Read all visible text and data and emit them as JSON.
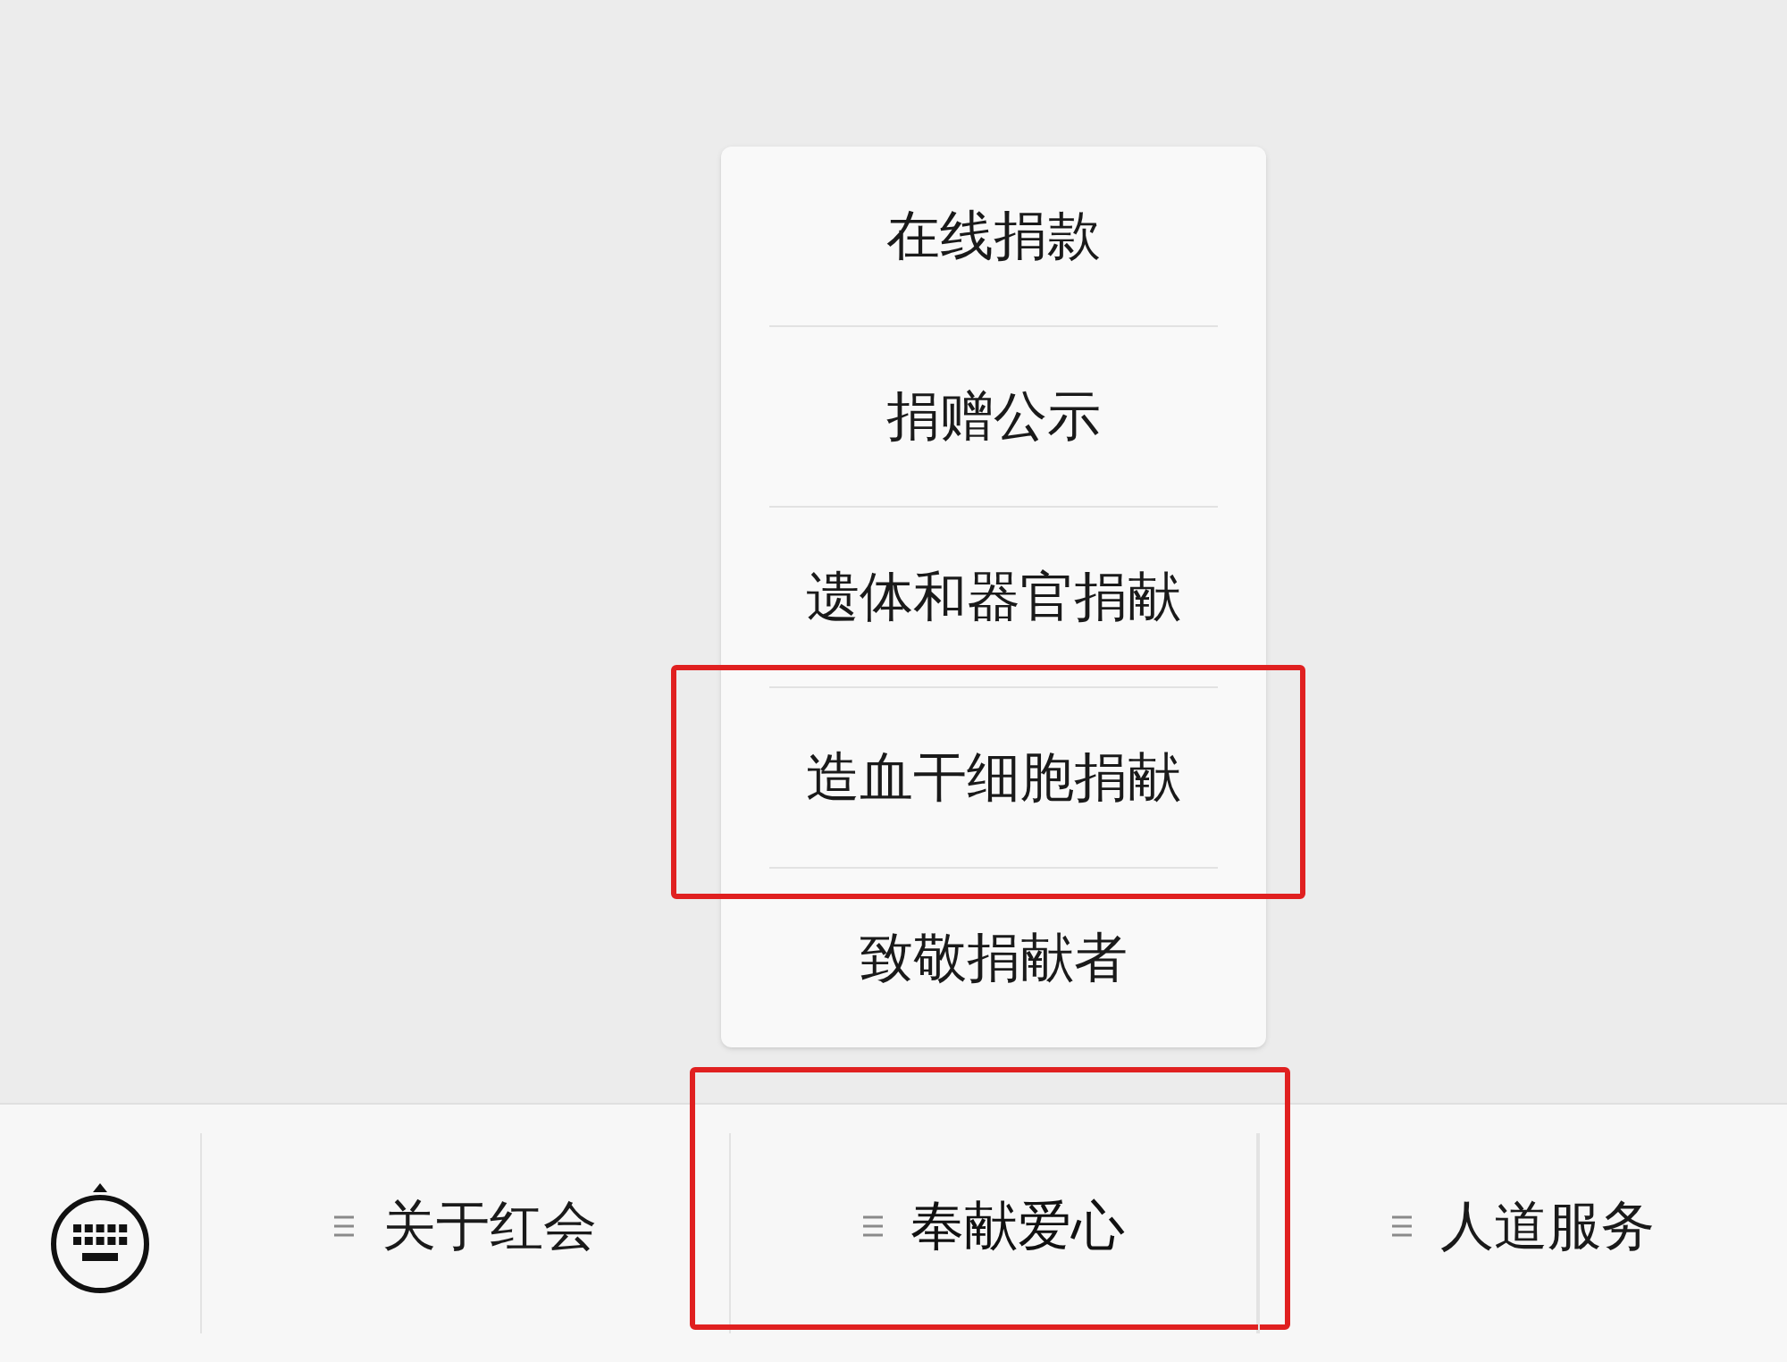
{
  "menu_bar": {
    "tabs": [
      {
        "label": "关于红会",
        "selected": false,
        "highlighted": false
      },
      {
        "label": "奉献爱心",
        "selected": true,
        "highlighted": true
      },
      {
        "label": "人道服务",
        "selected": false,
        "highlighted": false
      }
    ]
  },
  "submenu": {
    "items": [
      {
        "label": "在线捐款",
        "highlighted": false
      },
      {
        "label": "捐赠公示",
        "highlighted": false
      },
      {
        "label": "遗体和器官捐献",
        "highlighted": false
      },
      {
        "label": "造血干细胞捐献",
        "highlighted": true
      },
      {
        "label": "致敬捐献者",
        "highlighted": false
      }
    ]
  }
}
